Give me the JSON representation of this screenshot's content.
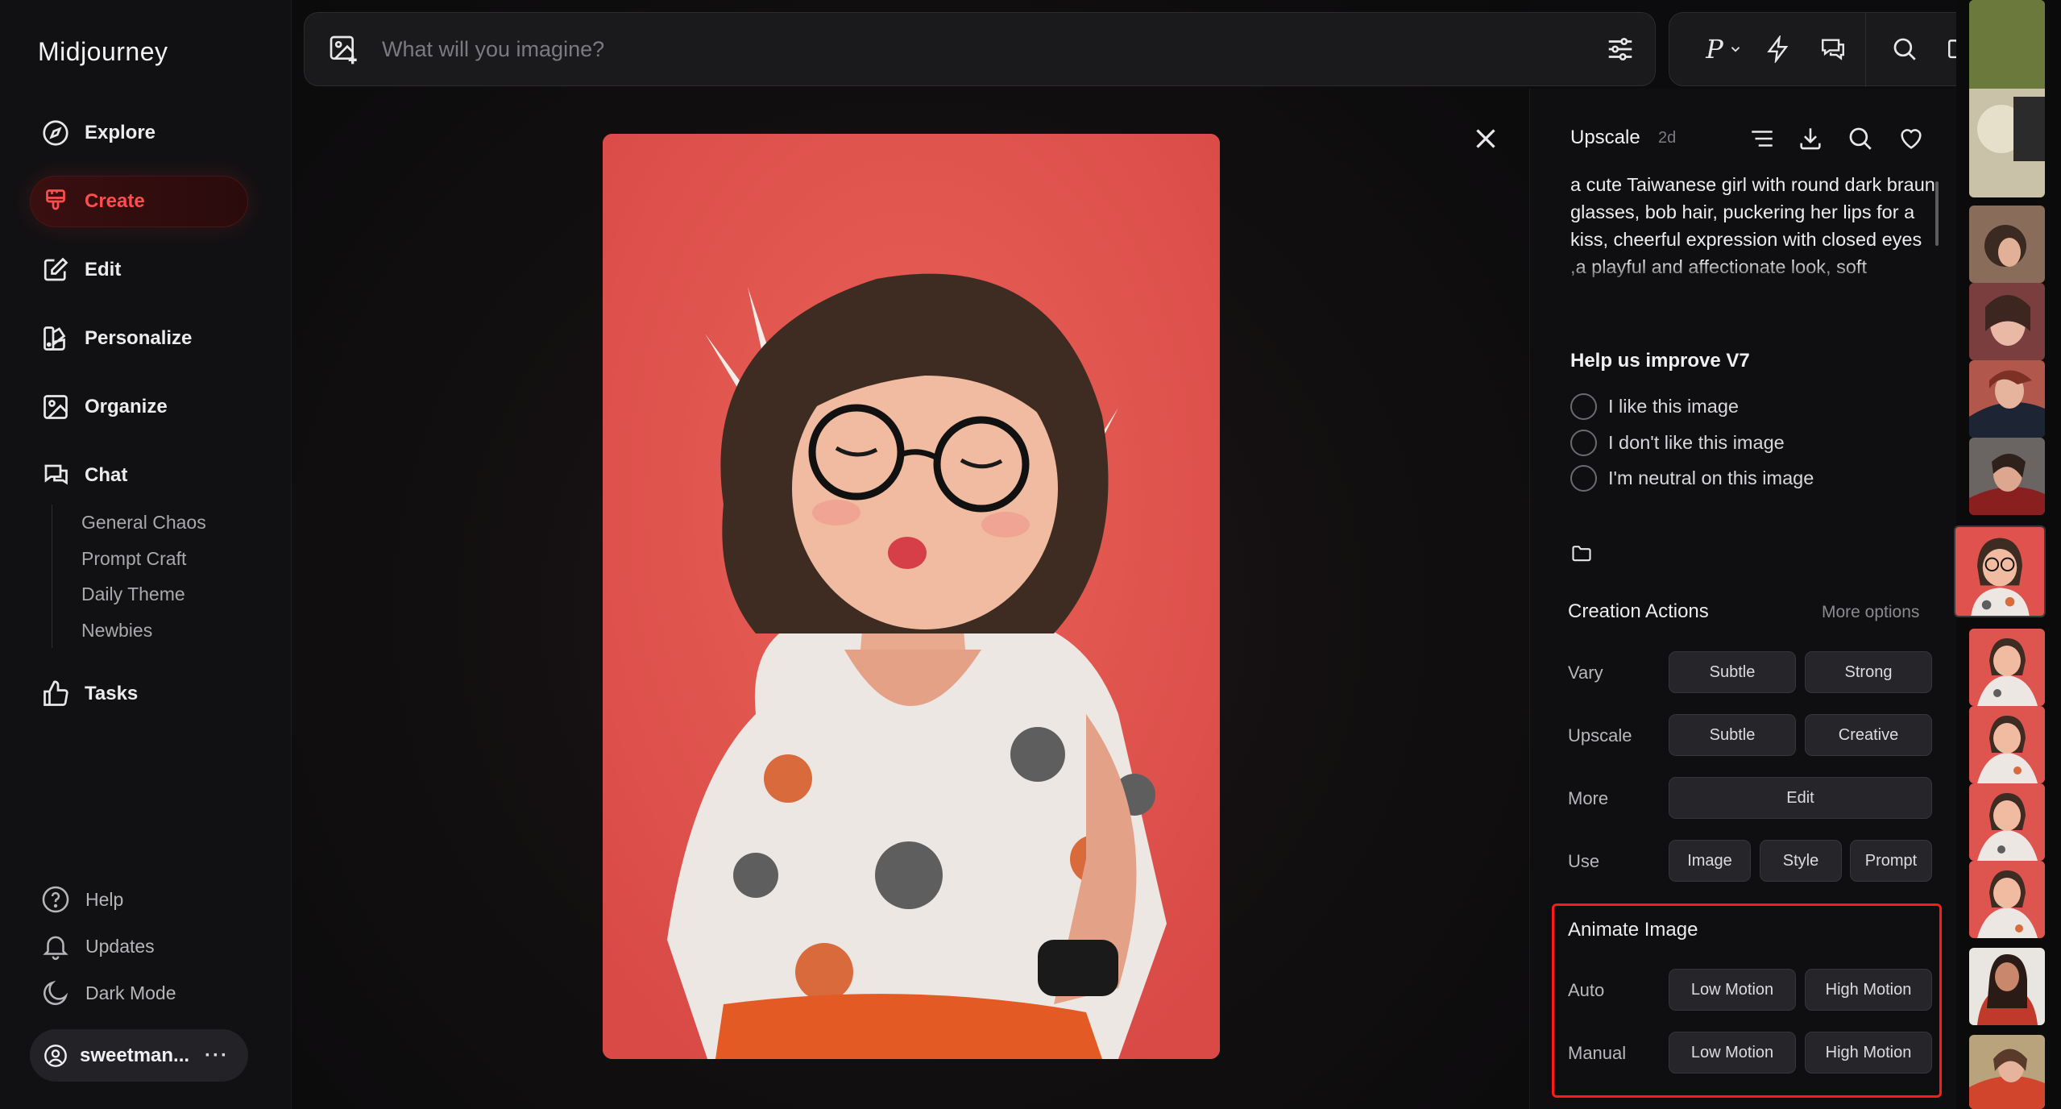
{
  "app": {
    "brand": "Midjourney"
  },
  "sidebar": {
    "items": [
      {
        "label": "Explore",
        "icon": "compass-icon"
      },
      {
        "label": "Create",
        "icon": "brush-icon",
        "active": true
      },
      {
        "label": "Edit",
        "icon": "edit-icon"
      },
      {
        "label": "Personalize",
        "icon": "palette-icon"
      },
      {
        "label": "Organize",
        "icon": "gallery-icon"
      },
      {
        "label": "Chat",
        "icon": "chat-icon"
      }
    ],
    "chat_rooms": [
      "General Chaos",
      "Prompt Craft",
      "Daily Theme",
      "Newbies"
    ],
    "tasks_label": "Tasks",
    "bottom": [
      {
        "label": "Help",
        "icon": "help-icon"
      },
      {
        "label": "Updates",
        "icon": "bell-icon"
      },
      {
        "label": "Dark Mode",
        "icon": "moon-icon"
      }
    ],
    "user": {
      "name": "sweetman...",
      "more": "···"
    }
  },
  "search": {
    "placeholder": "What will you imagine?"
  },
  "toolbar": {
    "personalize_letter": "P"
  },
  "detail": {
    "title": "Upscale",
    "age": "2d",
    "prompt": "a cute Taiwanese girl with round dark braun glasses, bob hair, puckering her lips for a kiss, cheerful expression with closed eyes ,a playful and affectionate look, soft",
    "improve": {
      "title": "Help us improve V7",
      "options": [
        "I like this image",
        "I don't like this image",
        "I'm neutral on this image"
      ]
    },
    "creation_actions": {
      "title": "Creation Actions",
      "more": "More options",
      "vary": {
        "label": "Vary",
        "buttons": [
          "Subtle",
          "Strong"
        ]
      },
      "upscale": {
        "label": "Upscale",
        "buttons": [
          "Subtle",
          "Creative"
        ]
      },
      "more_row": {
        "label": "More",
        "buttons": [
          "Edit"
        ]
      },
      "use": {
        "label": "Use",
        "buttons": [
          "Image",
          "Style",
          "Prompt"
        ]
      }
    },
    "animate": {
      "title": "Animate Image",
      "auto": {
        "label": "Auto",
        "buttons": [
          "Low Motion",
          "High Motion"
        ]
      },
      "manual": {
        "label": "Manual",
        "buttons": [
          "Low Motion",
          "High Motion"
        ]
      }
    }
  },
  "colors": {
    "accent": "#ff4d4d",
    "highlight_box": "#ff1a1a",
    "art_background": "#e0524d"
  }
}
